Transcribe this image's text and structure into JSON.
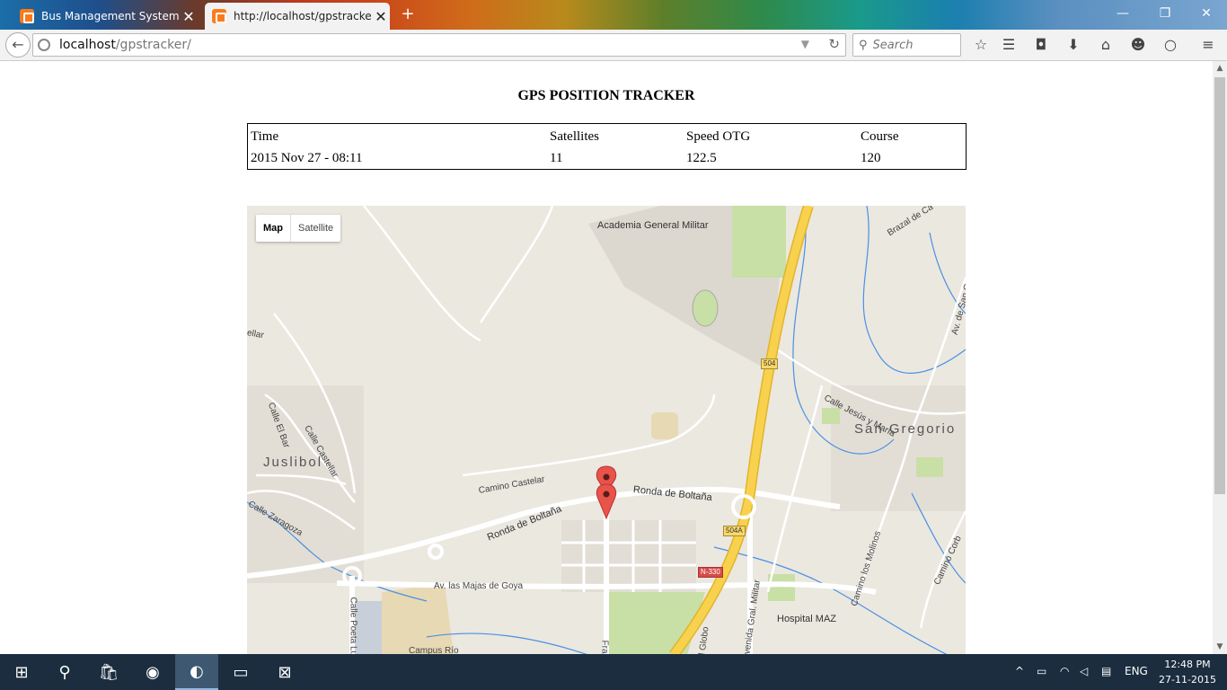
{
  "browser": {
    "tabs": [
      {
        "label": "Bus Management System",
        "active": false
      },
      {
        "label": "http://localhost/gpstracker/",
        "active": true
      }
    ],
    "url_host": "localhost",
    "url_path": "/gpstracker/",
    "search_placeholder": "Search"
  },
  "page": {
    "title": "GPS POSITION TRACKER",
    "table": {
      "headers": [
        "Time",
        "Satellites",
        "Speed OTG",
        "Course"
      ],
      "values": [
        "2015 Nov 27 - 08:11",
        "11",
        "122.5",
        "120"
      ]
    }
  },
  "map": {
    "type_options": [
      "Map",
      "Satellite"
    ],
    "selected_type": "Map",
    "labels": {
      "academia": "Academia General Militar",
      "san_gregorio": "San Gregorio",
      "juslibol": "Juslibol",
      "calle_jesus": "Calle Jesús y María",
      "camino_castelar": "Camino Castelar",
      "ronda_boltana_1": "Ronda de Boltaña",
      "ronda_boltana_2": "Ronda de Boltaña",
      "majas_goya": "Av. las Majas de Goya",
      "hospital": "Hospital MAZ",
      "calle_castellar": "Calle Castellar",
      "calle_el_bar": "Calle El Bar",
      "calle_zaragoza": "Calle Zaragoza",
      "camino_molinos": "Camino los Molinos",
      "campus_rio": "Campus Río",
      "av_gral_militar": "Avenida Gral. Militar",
      "calle_poeta": "Calle Poeta Lu",
      "fragua": "Fragua",
      "el_globo": "el Globo",
      "brazal": "Brazal de Ca",
      "av_san": "Av. de San G",
      "camino_corb": "Camino Corb",
      "calle_ellar": "ellar"
    },
    "road_badges": {
      "r504": "504",
      "r504a": "504A",
      "n330": "N-330"
    },
    "marker_count": 2
  },
  "taskbar": {
    "language": "ENG",
    "time": "12:48 PM",
    "date": "27-11-2015"
  },
  "colors": {
    "map_bg": "#ebe8e0",
    "highway": "#f8d24f",
    "marker": "#e8534a",
    "water": "#4a90e2",
    "park": "#c8dfa6"
  }
}
